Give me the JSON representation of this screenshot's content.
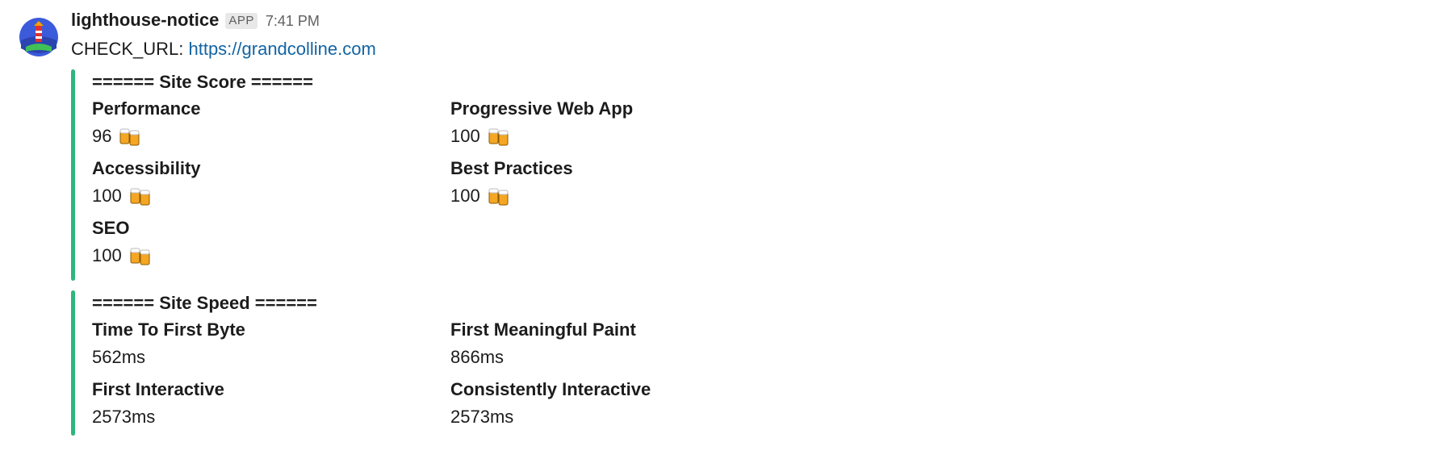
{
  "message": {
    "sender": "lighthouse-notice",
    "badge": "APP",
    "time": "7:41 PM",
    "check_label": "CHECK_URL: ",
    "check_url": "https://grandcolline.com"
  },
  "colors": {
    "attachment_bar": "#2eb67d",
    "link": "#1264a3",
    "avatar": "#3b5bdb"
  },
  "site_score": {
    "title": "====== Site Score ======",
    "fields": [
      {
        "title": "Performance",
        "value": "96",
        "icon": "beer-mugs-icon"
      },
      {
        "title": "Progressive Web App",
        "value": "100",
        "icon": "beer-mugs-icon"
      },
      {
        "title": "Accessibility",
        "value": "100",
        "icon": "beer-mugs-icon"
      },
      {
        "title": "Best Practices",
        "value": "100",
        "icon": "beer-mugs-icon"
      },
      {
        "title": "SEO",
        "value": "100",
        "icon": "beer-mugs-icon"
      }
    ]
  },
  "site_speed": {
    "title": "====== Site Speed ======",
    "fields": [
      {
        "title": "Time To First Byte",
        "value": "562ms"
      },
      {
        "title": "First Meaningful Paint",
        "value": "866ms"
      },
      {
        "title": "First Interactive",
        "value": "2573ms"
      },
      {
        "title": "Consistently Interactive",
        "value": "2573ms"
      }
    ]
  }
}
